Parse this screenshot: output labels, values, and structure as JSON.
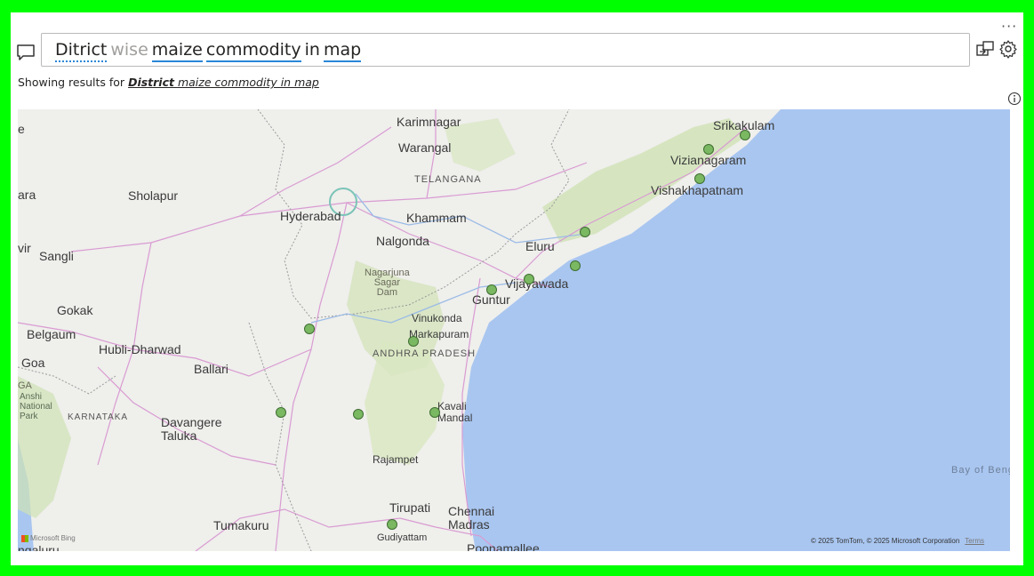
{
  "qa": {
    "tokens": [
      {
        "text": "Ditrict",
        "style": "dotted"
      },
      {
        "text": "wise",
        "style": "faint"
      },
      {
        "text": "maize",
        "style": "underline"
      },
      {
        "text": "commodity",
        "style": "underline"
      },
      {
        "text": "in",
        "style": "plain"
      },
      {
        "text": "map",
        "style": "underline"
      }
    ],
    "more_label": "···",
    "results_prefix": "Showing results for",
    "results_bold": "District",
    "results_rest": "maize commodity in map"
  },
  "icons": {
    "chat": "chat-icon",
    "turn_into_visual": "turn-into-visual-icon",
    "settings": "gear-icon",
    "info": "info-icon"
  },
  "map": {
    "labels": {
      "karimnagar": "Karimnagar",
      "warangal": "Warangal",
      "telangana": "TELANGANA",
      "srikakulam": "Srikakulam",
      "vizianagaram": "Vizianagaram",
      "vishakhapatnam": "Vishakhapatnam",
      "sholapur": "Sholapur",
      "hyderabad": "Hyderabad",
      "khammam": "Khammam",
      "nalgonda": "Nalgonda",
      "eluru": "Eluru",
      "sangli": "Sangli",
      "nagarjuna": "Nagarjuna\nSagar\nDam",
      "vijayawada": "Vijayawada",
      "guntur": "Guntur",
      "gokak": "Gokak",
      "vinukonda": "Vinukonda",
      "belgaum": "Belgaum",
      "markapuram": "Markapuram",
      "hubli": "Hubli-Dharwad",
      "andhra": "ANDHRA PRADESH",
      "goa": "Goa",
      "ballari": "Ballari",
      "anshi": "Anshi\nNational\nPark",
      "karnataka": "KARNATAKA",
      "kavali": "Kavali\nMandal",
      "davangere": "Davangere\nTaluka",
      "rajampet": "Rajampet",
      "bay": "Bay of Beng",
      "tirupati": "Tirupati",
      "chennai": "Chennai\nMadras",
      "tumakuru": "Tumakuru",
      "gudiyattam": "Gudiyattam",
      "poonamallee": "Poonamallee",
      "ara": "ara",
      "vir": "vir",
      "e": "e",
      "galuru": "ngaluru",
      "ga": "GA"
    },
    "copyright": "© 2025 TomTom, © 2025 Microsoft Corporation",
    "terms": "Terms",
    "bing": "Microsoft Bing",
    "colors": {
      "land": "#efefec",
      "water": "#a9c6f0",
      "point": "#7ab862",
      "road": "#d99bd2"
    }
  }
}
